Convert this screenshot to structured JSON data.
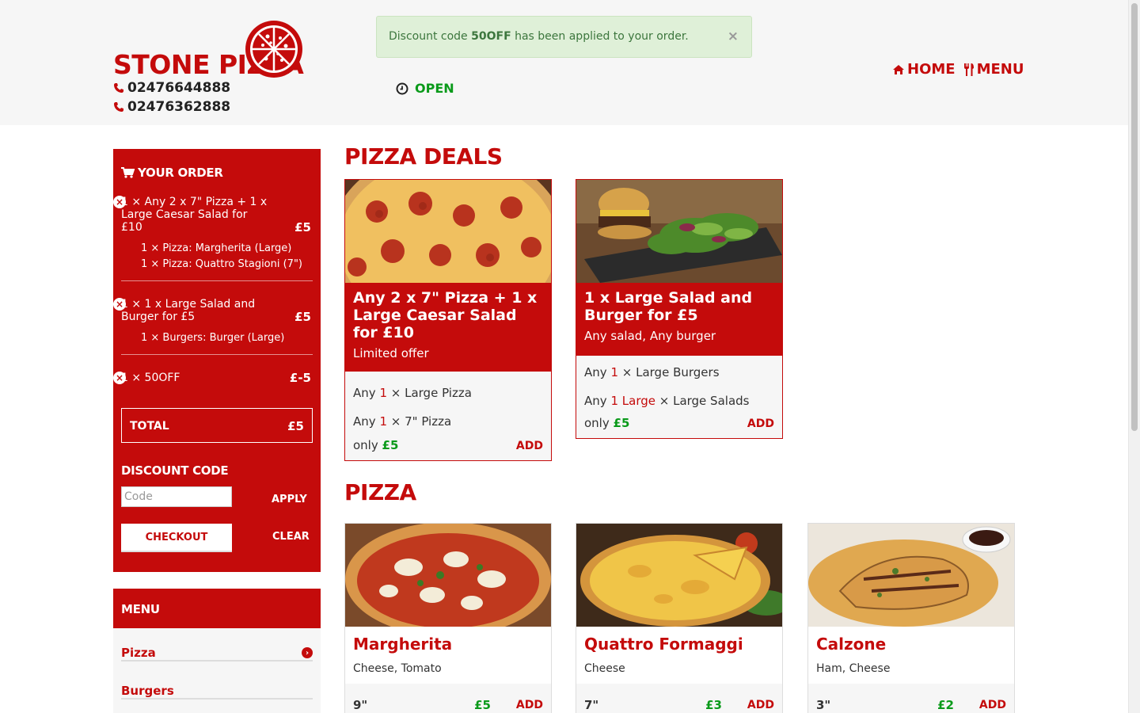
{
  "header": {
    "brand": "STONE PIZZA",
    "phones": [
      "02476644888",
      "02476362888"
    ],
    "alert": {
      "prefix": "Discount code ",
      "code": "50OFF",
      "suffix": " has been applied to your order.",
      "close": "×"
    },
    "status": "OPEN",
    "nav": [
      {
        "label": "HOME",
        "icon": "home-icon"
      },
      {
        "label": "MENU",
        "icon": "cutlery-icon"
      }
    ]
  },
  "order": {
    "title": "YOUR ORDER",
    "lines": [
      {
        "label": "1 × Any 2 x 7\" Pizza + 1 x Large Caesar Salad for £10",
        "price": "£5",
        "subitems": [
          "1 × Pizza: Margherita (Large)",
          "1 × Pizza: Quattro Stagioni (7\")"
        ]
      },
      {
        "label": "1 × 1 x Large Salad and Burger for £5",
        "price": "£5",
        "subitems": [
          "1 × Burgers: Burger (Large)"
        ]
      },
      {
        "label": "1 × 50OFF",
        "price": "£-5",
        "subitems": []
      }
    ],
    "total_label": "TOTAL",
    "total": "£5",
    "discount_label": "DISCOUNT CODE",
    "code_placeholder": "Code",
    "apply": "APPLY",
    "checkout": "CHECKOUT",
    "clear": "CLEAR"
  },
  "menu": {
    "title": "MENU",
    "items": [
      "Pizza",
      "Burgers"
    ]
  },
  "deals": {
    "title": "PIZZA DEALS",
    "cards": [
      {
        "title": "Any 2 x 7\" Pizza + 1 x Large Caesar Salad for £10",
        "desc": "Limited offer",
        "requirements": [
          {
            "any": "Any",
            "qty": "1",
            "size": "",
            "item": "× Large Pizza"
          },
          {
            "any": "Any",
            "qty": "1",
            "size": "",
            "item": "× 7\" Pizza"
          }
        ],
        "only": "only",
        "price": "£5",
        "add": "ADD"
      },
      {
        "title": "1 x Large Salad and Burger for £5",
        "desc": "Any salad, Any burger",
        "requirements": [
          {
            "any": "Any",
            "qty": "1",
            "size": "",
            "item": "× Large Burgers"
          },
          {
            "any": "Any",
            "qty": "1",
            "size": "Large",
            "item": "× Large Salads"
          }
        ],
        "only": "only",
        "price": "£5",
        "add": "ADD"
      }
    ]
  },
  "pizza": {
    "title": "PIZZA",
    "cards": [
      {
        "name": "Margherita",
        "ingredients": "Cheese, Tomato",
        "size": "9\"",
        "price": "£5",
        "add": "ADD"
      },
      {
        "name": "Quattro Formaggi",
        "ingredients": "Cheese",
        "size": "7\"",
        "price": "£3",
        "add": "ADD"
      },
      {
        "name": "Calzone",
        "ingredients": "Ham, Cheese",
        "size": "3\"",
        "price": "£2",
        "add": "ADD"
      }
    ]
  },
  "colors": {
    "brand_red": "#c40b0b",
    "price_green": "#0a9a1a",
    "alert_bg": "#dff0d8"
  }
}
